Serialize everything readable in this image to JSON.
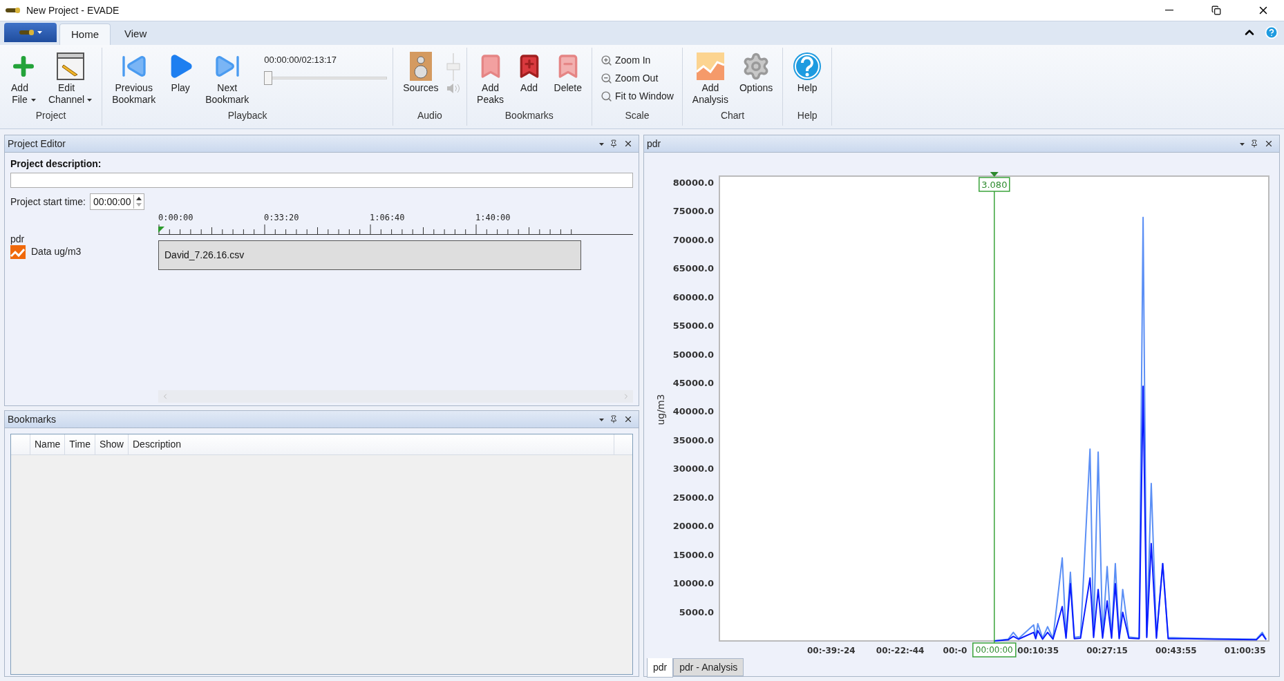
{
  "window": {
    "title": "New Project - EVADE"
  },
  "ribbon": {
    "tabs": [
      {
        "label": "Home",
        "selected": true
      },
      {
        "label": "View",
        "selected": false
      }
    ],
    "groups": [
      {
        "label": "Project",
        "items": [
          {
            "label": "Add File",
            "dropdown": true
          },
          {
            "label": "Edit Channel",
            "dropdown": true
          }
        ]
      },
      {
        "label": "Playback",
        "items": [
          {
            "label": "Previous Bookmark",
            "dropdown": false
          },
          {
            "label": "Play",
            "dropdown": false
          },
          {
            "label": "Next Bookmark",
            "dropdown": false
          }
        ],
        "position": {
          "time": "00:00:00/02:13:17",
          "level": 0
        }
      },
      {
        "label": "Audio",
        "items": [
          {
            "label": "Sources",
            "dropdown": false
          }
        ]
      },
      {
        "label": "Bookmarks",
        "items": [
          {
            "label": "Add Peaks",
            "dropdown": false
          },
          {
            "label": "Add",
            "dropdown": false
          },
          {
            "label": "Delete",
            "dropdown": false
          }
        ]
      },
      {
        "label": "Scale",
        "small_items": [
          "Zoom In",
          "Zoom Out",
          "Fit to Window"
        ]
      },
      {
        "label": "Chart",
        "items": [
          {
            "label": "Add Analysis",
            "dropdown": false
          },
          {
            "label": "Options",
            "dropdown": false
          }
        ]
      },
      {
        "label": "Help",
        "items": [
          {
            "label": "Help",
            "dropdown": false
          }
        ]
      }
    ]
  },
  "project_editor": {
    "title": "Project Editor",
    "description_label": "Project description:",
    "start_time_label": "Project start time:",
    "start_time": "00:00:00",
    "timeline_labels": [
      "0:00:00",
      "0:33:20",
      "1:06:40",
      "1:40:00"
    ],
    "channel": {
      "name": "pdr",
      "data_label": "Data ug/m3",
      "file": "David_7.26.16.csv"
    }
  },
  "bookmarks": {
    "title": "Bookmarks",
    "columns": [
      "Name",
      "Time",
      "Show",
      "Description"
    ]
  },
  "chart_panel": {
    "title": "pdr",
    "chart_data": {
      "type": "line",
      "ylabel": "ug/m3",
      "xlim": [
        -3985,
        3979
      ],
      "ylim": [
        0,
        81200
      ],
      "ref_lines": [
        {
          "axis": "x",
          "value": 0,
          "label": "00:00:00",
          "color": "#3aa33a"
        }
      ],
      "annotations": [
        {
          "x": 0,
          "text": "3.080"
        }
      ],
      "xticks": [
        {
          "value": -2364,
          "label": "00:-39:-24"
        },
        {
          "value": -1364,
          "label": "00:-22:-44"
        },
        {
          "value": -569,
          "label": "00:-0"
        },
        {
          "value": 635,
          "label": "00:10:35"
        },
        {
          "value": 1635,
          "label": "00:27:15"
        },
        {
          "value": 2635,
          "label": "00:43:55"
        },
        {
          "value": 3635,
          "label": "01:00:35"
        }
      ],
      "yticks": [
        {
          "value": 5000,
          "label": "5000.0"
        },
        {
          "value": 10000,
          "label": "10000.0"
        },
        {
          "value": 15000,
          "label": "15000.0"
        },
        {
          "value": 20000,
          "label": "20000.0"
        },
        {
          "value": 25000,
          "label": "25000.0"
        },
        {
          "value": 30000,
          "label": "30000.0"
        },
        {
          "value": 35000,
          "label": "35000.0"
        },
        {
          "value": 40000,
          "label": "40000.0"
        },
        {
          "value": 45000,
          "label": "45000.0"
        },
        {
          "value": 50000,
          "label": "50000.0"
        },
        {
          "value": 55000,
          "label": "55000.0"
        },
        {
          "value": 60000,
          "label": "60000.0"
        },
        {
          "value": 65000,
          "label": "65000.0"
        },
        {
          "value": 70000,
          "label": "70000.0"
        },
        {
          "value": 75000,
          "label": "75000.0"
        },
        {
          "value": 80000,
          "label": "80000.0"
        }
      ],
      "x": [
        0,
        200,
        275,
        350,
        571,
        600,
        630,
        700,
        772,
        850,
        985,
        1040,
        1103,
        1160,
        1250,
        1387,
        1440,
        1506,
        1570,
        1636,
        1700,
        1754,
        1810,
        1861,
        1950,
        2100,
        2157,
        2210,
        2275,
        2350,
        2441,
        2520,
        2800,
        3200,
        3800,
        3884,
        3940
      ],
      "series": [
        {
          "color": "#5b8ff5",
          "values": [
            0,
            300,
            1500,
            400,
            2800,
            600,
            3000,
            500,
            2500,
            400,
            14500,
            700,
            12000,
            600,
            800,
            33500,
            900,
            33000,
            800,
            13000,
            700,
            13500,
            600,
            9000,
            700,
            500,
            74000,
            800,
            27500,
            700,
            13500,
            600,
            500,
            400,
            300,
            1500,
            300
          ]
        },
        {
          "color": "#0a1cff",
          "values": [
            0,
            200,
            800,
            300,
            1500,
            400,
            1800,
            300,
            1500,
            300,
            6000,
            500,
            10000,
            400,
            500,
            11000,
            600,
            9000,
            500,
            7000,
            500,
            10000,
            400,
            5000,
            500,
            400,
            44500,
            600,
            17000,
            500,
            13500,
            400,
            400,
            300,
            200,
            1200,
            200
          ]
        }
      ]
    },
    "tabs": [
      {
        "label": "pdr",
        "selected": true
      },
      {
        "label": "pdr - Analysis",
        "selected": false
      }
    ]
  }
}
